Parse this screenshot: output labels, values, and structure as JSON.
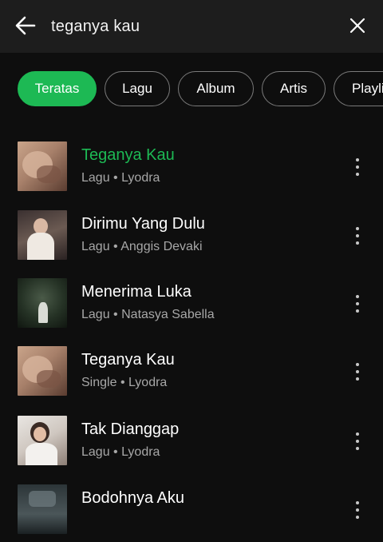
{
  "search": {
    "query": "teganya kau"
  },
  "filters": [
    {
      "label": "Teratas",
      "active": true
    },
    {
      "label": "Lagu",
      "active": false
    },
    {
      "label": "Album",
      "active": false
    },
    {
      "label": "Artis",
      "active": false
    },
    {
      "label": "Playli",
      "active": false
    }
  ],
  "results": [
    {
      "title": "Teganya Kau",
      "type": "Lagu",
      "artist": "Lyodra",
      "playing": true
    },
    {
      "title": "Dirimu Yang Dulu",
      "type": "Lagu",
      "artist": "Anggis Devaki",
      "playing": false
    },
    {
      "title": "Menerima Luka",
      "type": "Lagu",
      "artist": "Natasya Sabella",
      "playing": false
    },
    {
      "title": "Teganya Kau",
      "type": "Single",
      "artist": "Lyodra",
      "playing": false
    },
    {
      "title": "Tak Dianggap",
      "type": "Lagu",
      "artist": "Lyodra",
      "playing": false
    },
    {
      "title": "Bodohnya Aku",
      "type": "",
      "artist": "",
      "playing": false
    }
  ],
  "separator": "•",
  "colors": {
    "accent": "#1db954",
    "background": "#0e0e0e",
    "header": "#1d1d1d",
    "secondary_text": "#a7a7a7"
  },
  "icons": {
    "back": "arrow-left-icon",
    "clear": "close-icon",
    "more": "more-vertical-icon"
  }
}
